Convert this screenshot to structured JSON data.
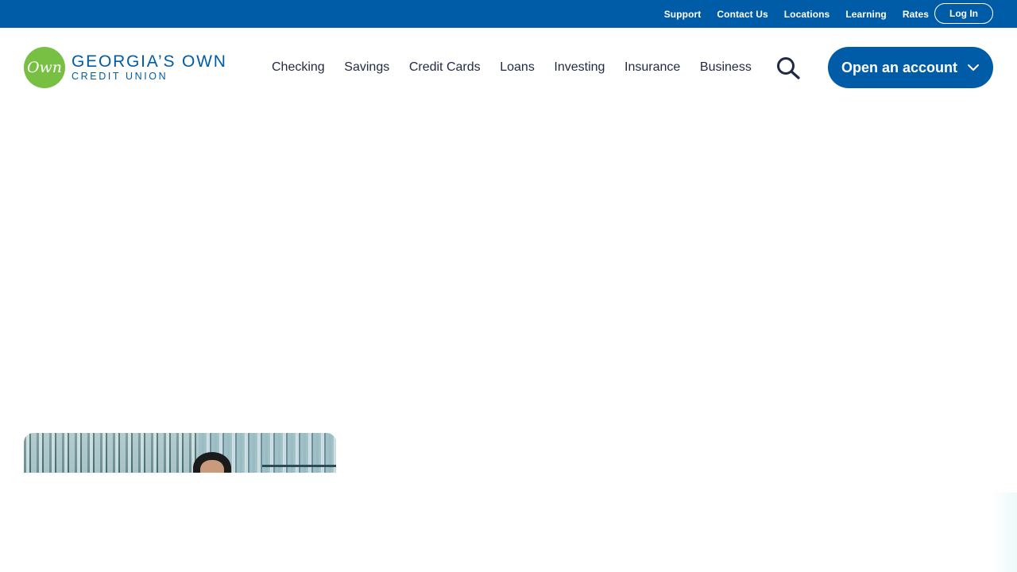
{
  "utility_nav": {
    "links": [
      "Support",
      "Contact Us",
      "Locations",
      "Learning",
      "Rates"
    ],
    "login_label": "Log In"
  },
  "header": {
    "logo": {
      "badge_text": "Own",
      "name": "GEORGIA’S OWN",
      "sub": "CREDIT UNION"
    },
    "nav_items": [
      "Checking",
      "Savings",
      "Credit Cards",
      "Loans",
      "Investing",
      "Insurance",
      "Business"
    ],
    "search_icon": "search-icon",
    "cta_label": "Open an account",
    "cta_icon": "chevron-down-icon"
  },
  "colors": {
    "brand_blue": "#005ca7",
    "logo_green": "#78c043",
    "nav_text": "#1f2a44",
    "background": "#ffffff"
  }
}
